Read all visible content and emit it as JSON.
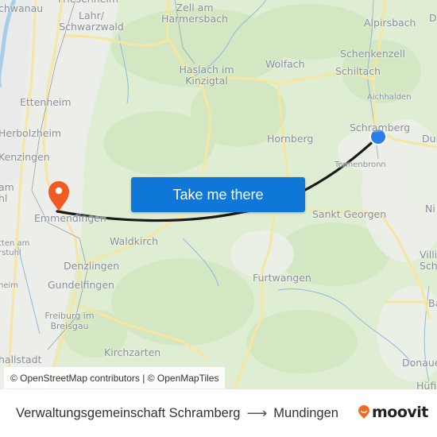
{
  "map": {
    "places": [
      {
        "id": "schwanau",
        "label": "Schwanau",
        "visible": "chwanau"
      },
      {
        "id": "friesenheim",
        "label": "Friesenheim"
      },
      {
        "id": "lahr",
        "label": "Lahr/\nSchwarzwald",
        "line1": "Lahr/",
        "line2": "Schwarzwald"
      },
      {
        "id": "zell",
        "line1": "Zell am",
        "line2": "Harmersbach"
      },
      {
        "id": "alpirsbach",
        "label": "Alpirsbach"
      },
      {
        "id": "schenkenzell",
        "label": "Schenkenzell"
      },
      {
        "id": "wolfach",
        "label": "Wolfach"
      },
      {
        "id": "haslach",
        "line1": "Haslach im",
        "line2": "Kinzigtal"
      },
      {
        "id": "schiltach",
        "label": "Schiltach"
      },
      {
        "id": "aichhalden",
        "label": "Aichhalden"
      },
      {
        "id": "ettenheim",
        "label": "Ettenheim"
      },
      {
        "id": "schramberg",
        "label": "Schramberg"
      },
      {
        "id": "herbolzheim",
        "label": "Herbolzheim"
      },
      {
        "id": "hornberg",
        "label": "Hornberg"
      },
      {
        "id": "kenzingen",
        "label": "Kenzingen"
      },
      {
        "id": "tennenbronn",
        "label": "Tennenbronn"
      },
      {
        "id": "endingen",
        "line1": "am",
        "line2": "hl"
      },
      {
        "id": "emmendingen",
        "label": "Emmendingen"
      },
      {
        "id": "sankt-georgen",
        "label": "Sankt Georgen"
      },
      {
        "id": "waldkirch",
        "label": "Waldkirch"
      },
      {
        "id": "ihringen",
        "line1": "tten am",
        "line2": "rstuhl"
      },
      {
        "id": "denzlingen",
        "label": "Denzlingen"
      },
      {
        "id": "gundelfingen",
        "label": "Gundelfingen"
      },
      {
        "id": "umkirch",
        "label": "heim"
      },
      {
        "id": "furtwangen",
        "label": "Furtwangen"
      },
      {
        "id": "villingen",
        "line1": "Villi",
        "line2": "Schwe"
      },
      {
        "id": "freiburg",
        "line1": "Freiburg im",
        "line2": "Breisgau"
      },
      {
        "id": "kirchzarten",
        "label": "Kirchzarten"
      },
      {
        "id": "merzhausen",
        "label": "hallstadt"
      },
      {
        "id": "donaueschingen",
        "label": "Donaue"
      },
      {
        "id": "huefingen",
        "label": "Hüfi"
      },
      {
        "id": "dunningen",
        "label": "Du"
      },
      {
        "id": "dornhan",
        "label": "D"
      },
      {
        "id": "niedereschach",
        "label": "Ni"
      },
      {
        "id": "bad-duerrheim",
        "label": "Ba"
      }
    ],
    "origin_marker": {
      "label": "Verwaltungsgemeinschaft Schramberg",
      "color": "#2b7de9"
    },
    "destination_marker": {
      "label": "Mundingen",
      "color": "#f25a23"
    },
    "route_color": "#1a1a1a",
    "cta_button": {
      "label": "Take me there",
      "color": "#0f77d7"
    },
    "attribution": "© OpenStreetMap contributors | © OpenMapTiles"
  },
  "footer": {
    "origin": "Verwaltungsgemeinschaft Schramberg",
    "arrow": "⟶",
    "destination": "Mundingen",
    "brand": "moovit",
    "brand_color": "#f26a21"
  }
}
